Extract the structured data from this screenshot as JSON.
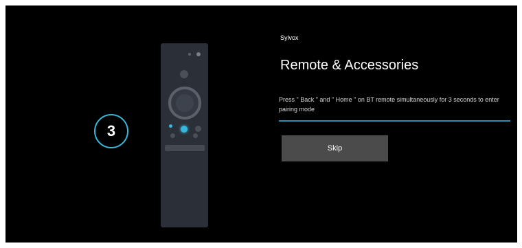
{
  "step": {
    "number": "3",
    "accent_color": "#36b7dc"
  },
  "header": {
    "brand": "Sylvox",
    "title": "Remote & Accessories"
  },
  "main": {
    "instructions": "Press \" Back \" and \" Home \" on BT remote simultaneously for 3 seconds to enter pairing mode",
    "skip_label": "Skip"
  },
  "illustration": {
    "device": "bluetooth-remote",
    "highlight_color": "#36b7dc"
  }
}
